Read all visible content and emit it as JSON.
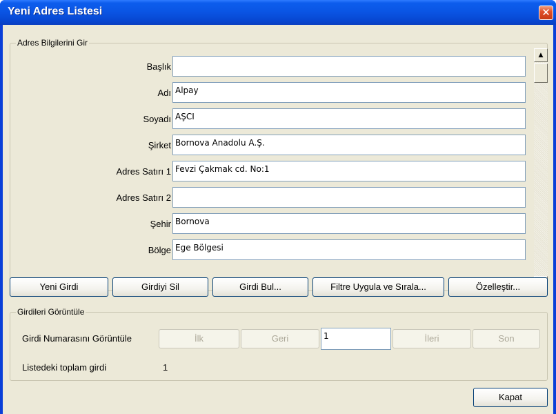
{
  "window": {
    "title": "Yeni Adres Listesi",
    "close_glyph": "✕"
  },
  "address_group": {
    "legend": "Adres Bilgilerini Gir",
    "fields": [
      {
        "label": "Başlık",
        "value": ""
      },
      {
        "label": "Adı",
        "value": "Alpay"
      },
      {
        "label": "Soyadı",
        "value": "AŞCI"
      },
      {
        "label": "Şirket",
        "value": "Bornova Anadolu A.Ş."
      },
      {
        "label": "Adres Satırı 1",
        "value": "Fevzi Çakmak cd. No:1"
      },
      {
        "label": "Adres Satırı 2",
        "value": ""
      },
      {
        "label": "Şehir",
        "value": "Bornova"
      },
      {
        "label": "Bölge",
        "value": "Ege Bölgesi"
      }
    ],
    "scroll_up_glyph": "▲",
    "scroll_down_glyph": "▼"
  },
  "actions": {
    "new_entry": "Yeni Girdi",
    "delete_entry": "Girdiyi Sil",
    "find_entry": "Girdi Bul...",
    "filter_sort": "Filtre Uygula ve Sırala...",
    "customize": "Özelleştir..."
  },
  "view_group": {
    "legend": "Girdileri Görüntüle",
    "show_number_label": "Girdi Numarasını Görüntüle",
    "first": "İlk",
    "previous": "Geri",
    "entry_number": "1",
    "next": "İleri",
    "last": "Son",
    "total_label": "Listedeki toplam girdi",
    "total_value": "1"
  },
  "footer": {
    "close": "Kapat"
  }
}
